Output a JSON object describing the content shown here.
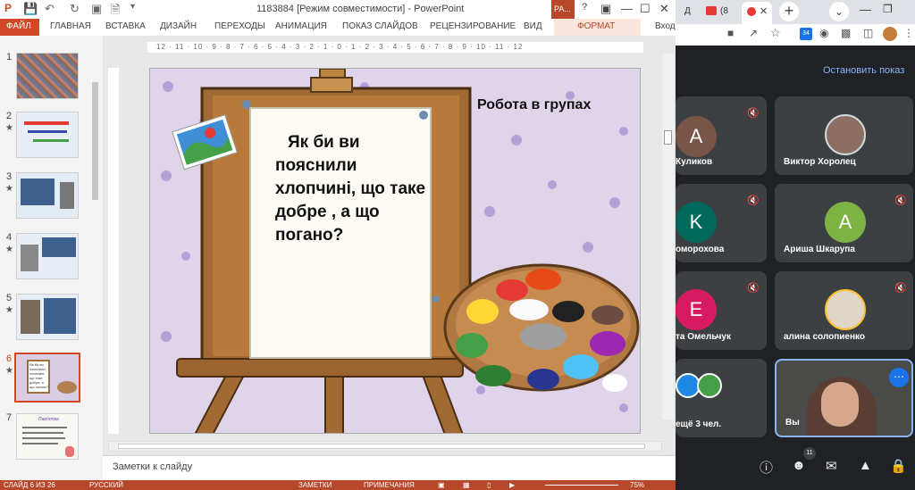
{
  "colors": {
    "accent": "#d24726",
    "status_bar": "#b7472a",
    "meet_bg": "#202124",
    "tile_bg": "#3c4043",
    "link": "#8ab4f8"
  },
  "ppt": {
    "window_title": "1183884 [Режим совместимости] - PowerPoint",
    "context_tab": "РА...",
    "help": "?",
    "ribbon": {
      "file": "ФАЙЛ",
      "tabs": [
        "ГЛАВНАЯ",
        "ВСТАВКА",
        "ДИЗАЙН",
        "ПЕРЕХОДЫ",
        "АНИМАЦИЯ",
        "ПОКАЗ СЛАЙДОВ",
        "РЕЦЕНЗИРОВАНИЕ",
        "ВИД"
      ],
      "format": "ФОРМАТ",
      "signin": "Вход"
    },
    "ruler_text": "12 · 11 · 10 · 9 · 8 · 7 · 6 · 5 · 4 · 3 · 2 · 1 · 0 · 1 · 2 · 3 · 4 · 5 · 6 · 7 · 8 · 9 · 10 · 11 · 12",
    "slide_numbers": [
      "1",
      "2",
      "3",
      "4",
      "5",
      "6",
      "7"
    ],
    "selected_slide": "6",
    "slide": {
      "question": "Як би ви пояснили хлопчині, що таке  добре , а що погано?",
      "caption": "Робота в групах"
    },
    "thumbs": {
      "t6_text": "Як би ви пояснили хлопчині, що таке добре, а що погано?",
      "t7_title": "Пам'ятка"
    },
    "notes_placeholder": "Заметки к слайду",
    "status": {
      "slide_info": "СЛАЙД 6 ИЗ 26",
      "language": "РУССКИЙ",
      "notes": "ЗАМЕТКИ",
      "comments": "ПРИМЕЧАНИЯ",
      "zoom": "75%"
    }
  },
  "chrome": {
    "tabs": [
      "Д",
      "(8"
    ],
    "notif_count": "34"
  },
  "meet": {
    "stop_presenting": "Остановить показ",
    "tiles": [
      {
        "initial": "А",
        "name": "Куликов",
        "color": "#795548"
      },
      {
        "initial": "",
        "name": "Виктор Хоролец",
        "color": "#8d6e63"
      },
      {
        "initial": "K",
        "name": "оморохова",
        "color": "#00695c"
      },
      {
        "initial": "A",
        "name": "Ариша Шкарупа",
        "color": "#7cb342"
      },
      {
        "initial": "E",
        "name": "та Омельчук",
        "color": "#d81b60"
      },
      {
        "initial": "",
        "name": "алина солопиенко",
        "color": "#b0a090"
      },
      {
        "initial": "",
        "name": "ещё 3 чел.",
        "color": "#3c4043"
      },
      {
        "initial": "",
        "name": "Вы",
        "color": "#5a4a40"
      }
    ],
    "people_count": "11"
  }
}
